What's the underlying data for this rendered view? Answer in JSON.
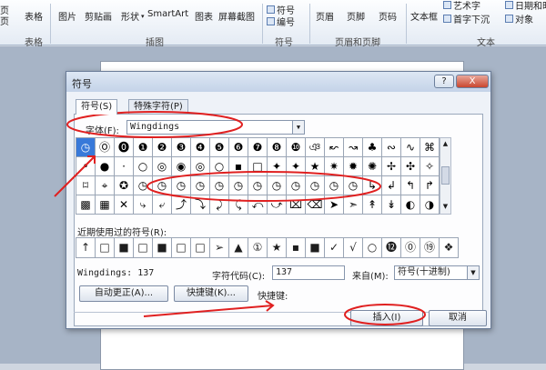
{
  "ribbon": {
    "left_cut_1": "页",
    "left_cut_2": "页",
    "table_label": "表格",
    "items": [
      "图片",
      "剪贴画",
      "形状",
      "SmartArt",
      "图表",
      "屏幕截图"
    ],
    "symbol_items": [
      "符号",
      "编号"
    ],
    "hf_items": [
      "页眉",
      "页脚",
      "页码"
    ],
    "text_items": [
      "文本框",
      "艺术字",
      "首字下沉",
      "日期和时",
      "对象"
    ],
    "groups": {
      "tables": "表格",
      "illustrations": "插图",
      "symbols": "符号",
      "header_footer": "页眉和页脚",
      "text": "文本"
    }
  },
  "dialog": {
    "title": "符号",
    "help": "?",
    "close": "X",
    "tabs": [
      "符号(S)",
      "特殊字符(P)"
    ],
    "font_label": "字体(F):",
    "font_value": "Wingdings",
    "grid": [
      [
        "◷",
        "Ⓞ",
        "⓿",
        "❶",
        "❷",
        "❸",
        "❹",
        "❺",
        "❻",
        "❼",
        "❽",
        "❿",
        "ঞ",
        "↜",
        "↝",
        "♣",
        "∾",
        "∿",
        "⌘"
      ],
      [
        "•",
        "●",
        "·",
        "○",
        "◎",
        "◉",
        "◎",
        "○",
        "▪",
        "□",
        "✦",
        "✦",
        "★",
        "✷",
        "✹",
        "✺",
        "✢",
        "✣",
        "✧"
      ],
      [
        "⌑",
        "⌖",
        "✪",
        "◷",
        "◷",
        "◷",
        "◷",
        "◷",
        "◷",
        "◷",
        "◷",
        "◷",
        "◷",
        "◷",
        "◷",
        "↳",
        "↲",
        "↰",
        "↱"
      ],
      [
        "▩",
        "▦",
        "✕",
        "⤷",
        "⤶",
        "⤴",
        "⤵",
        "⤸",
        "⤹",
        "⤺",
        "⤻",
        "⌧",
        "⌫",
        "➤",
        "➣",
        "↟",
        "↡",
        "◐",
        "◑"
      ]
    ],
    "recent_label": "近期使用过的符号(R):",
    "recent": [
      "↑",
      "□",
      "■",
      "□",
      "■",
      "□",
      "□",
      "➢",
      "▲",
      "①",
      "★",
      "▪",
      "■",
      "✓",
      "√",
      "○",
      "⓬",
      "⓪",
      "⑲",
      "❖"
    ],
    "info_font": "Wingdings: 137",
    "code_label": "字符代码(C):",
    "code_value": "137",
    "from_label": "来自(M):",
    "from_value": "符号(十进制)",
    "autocorrect": "自动更正(A)...",
    "shortcut_btn": "快捷键(K)...",
    "shortcut_label": "快捷键:",
    "insert": "插入(I)",
    "cancel": "取消"
  },
  "colors": {
    "annotation_red": "#e02020",
    "selection_blue": "#3879d9"
  }
}
